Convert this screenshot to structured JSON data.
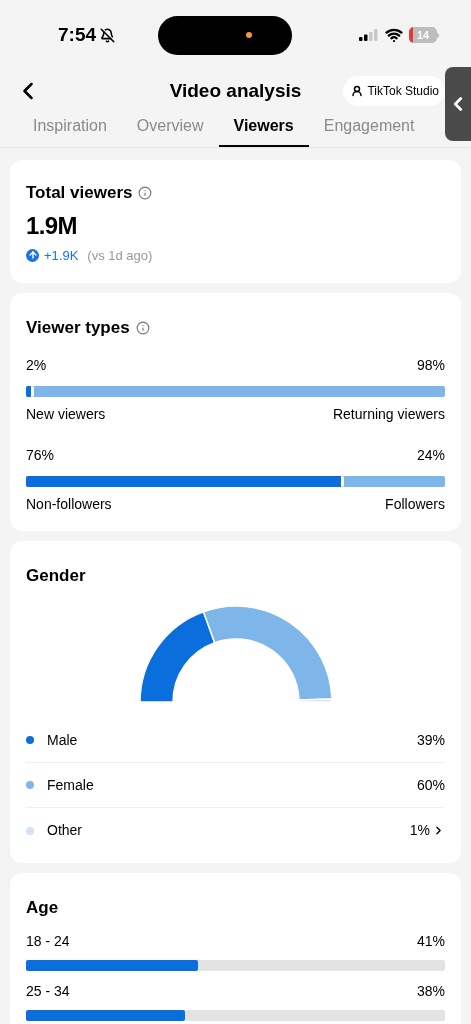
{
  "status_bar": {
    "time": "7:54",
    "battery": "14"
  },
  "header": {
    "title": "Video analysis",
    "studio_button": "TikTok Studio"
  },
  "tabs": [
    {
      "label": "Inspiration",
      "selected": false
    },
    {
      "label": "Overview",
      "selected": false
    },
    {
      "label": "Viewers",
      "selected": true
    },
    {
      "label": "Engagement",
      "selected": false
    }
  ],
  "total_viewers": {
    "title": "Total viewers",
    "value": "1.9M",
    "change": "+1.9K",
    "comparison": "(vs 1d ago)"
  },
  "viewer_types": {
    "title": "Viewer types",
    "splits": [
      {
        "left_value": "2%",
        "right_value": "98%",
        "left_label": "New viewers",
        "right_label": "Returning viewers",
        "level": 0.02
      },
      {
        "left_value": "76%",
        "right_value": "24%",
        "left_label": "Non-followers",
        "right_label": "Followers",
        "level": 0.76
      }
    ]
  },
  "gender": {
    "chart_data": {
      "type": "donut",
      "title": "Gender",
      "categories": [
        "Male",
        "Female",
        "Other"
      ],
      "series": [
        {
          "values": [
            39,
            60,
            1
          ]
        }
      ]
    },
    "items": [
      {
        "value": "39%",
        "color": "#0a6fdc",
        "has_more": false
      },
      {
        "value": "60%",
        "color": "#7fb6ea",
        "has_more": false
      },
      {
        "value": "1%",
        "color": "#d3e3f5",
        "has_more": true
      }
    ]
  },
  "age": {
    "title": "Age",
    "groups": [
      {
        "label": "18 - 24",
        "value": "41%",
        "level": 0.41
      },
      {
        "label": "25 - 34",
        "value": "38%",
        "level": 0.38
      }
    ]
  }
}
